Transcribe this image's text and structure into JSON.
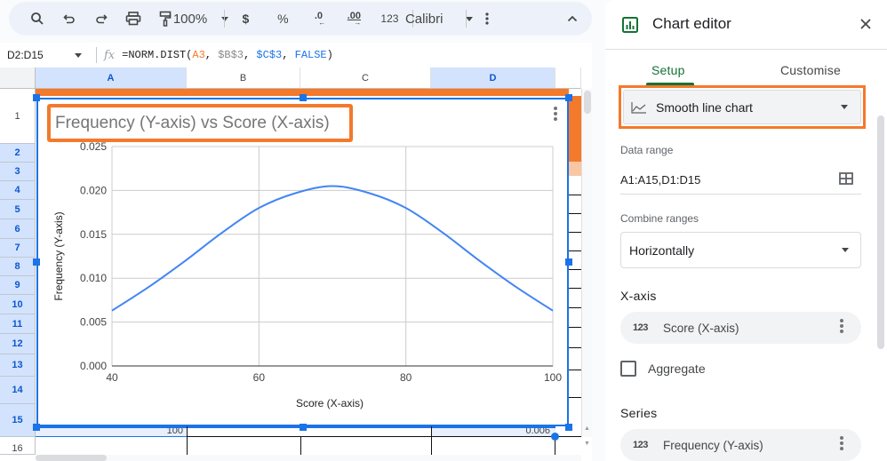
{
  "toolbar": {
    "zoom": "100%",
    "currency": "$",
    "percent": "%",
    "decrease_decimal": ".0",
    "increase_decimal": ".00",
    "number_format": "123",
    "font": "Calibri"
  },
  "formula_bar": {
    "name_box": "D2:D15",
    "fx_label": "fx",
    "formula_prefix": "=NORM.DIST(",
    "ref_a3": "A3",
    "sep1": ", ",
    "ref_b3": "$B$3",
    "sep2": ", ",
    "ref_c3": "$C$3",
    "sep3": ", ",
    "arg_false": "FALSE",
    "formula_suffix": ")"
  },
  "grid": {
    "columns": [
      "A",
      "B",
      "C",
      "D"
    ],
    "selected_columns": [
      "A",
      "D"
    ],
    "rows": [
      "1",
      "2",
      "3",
      "4",
      "5",
      "6",
      "7",
      "8",
      "9",
      "10",
      "11",
      "12",
      "13",
      "14",
      "15",
      "16"
    ],
    "visible_cells": {
      "A15": "100",
      "D15": "0.006"
    }
  },
  "chart": {
    "menu_icon": "more-vert-icon"
  },
  "chart_data": {
    "type": "line",
    "smooth": true,
    "title": "Frequency (Y-axis) vs Score (X-axis)",
    "xlabel": "Score (X-axis)",
    "ylabel": "Frequency (Y-axis)",
    "xlim": [
      40,
      100
    ],
    "ylim": [
      0,
      0.025
    ],
    "x_ticks": [
      "40",
      "60",
      "80",
      "100"
    ],
    "y_ticks": [
      "0.000",
      "0.005",
      "0.010",
      "0.015",
      "0.020",
      "0.025"
    ],
    "grid": true,
    "legend": "none",
    "series": [
      {
        "name": "Frequency (Y-axis)",
        "color": "#4285f4",
        "x": [
          40,
          45,
          50,
          55,
          60,
          65,
          70,
          75,
          80,
          85,
          90,
          95,
          100
        ],
        "values": [
          0.0063,
          0.009,
          0.012,
          0.0152,
          0.018,
          0.0197,
          0.0205,
          0.0197,
          0.018,
          0.0152,
          0.012,
          0.009,
          0.0063
        ]
      }
    ]
  },
  "editor": {
    "title": "Chart editor",
    "tabs": [
      {
        "label": "Setup",
        "active": true
      },
      {
        "label": "Customise",
        "active": false
      }
    ],
    "chart_type": "Smooth line chart",
    "data_range_label": "Data range",
    "data_range_value": "A1:A15,D1:D15",
    "combine_ranges_label": "Combine ranges",
    "combine_ranges_value": "Horizontally",
    "x_axis_label": "X-axis",
    "x_axis_item": {
      "type_badge": "123",
      "label": "Score (X-axis)"
    },
    "aggregate_label": "Aggregate",
    "aggregate_checked": false,
    "series_label": "Series",
    "series_item": {
      "type_badge": "123",
      "label": "Frequency (Y-axis)"
    }
  },
  "colors": {
    "accent_orange": "#f4792b",
    "selection_blue": "#1a73e8",
    "series_blue": "#4285f4",
    "setup_green": "#137333"
  }
}
